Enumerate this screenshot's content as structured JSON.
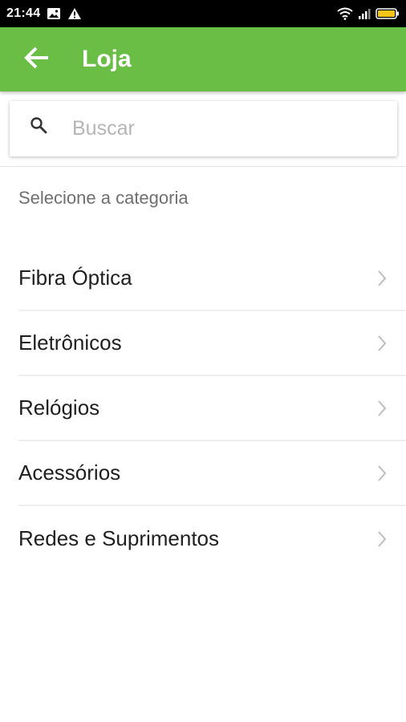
{
  "status_bar": {
    "time": "21:44",
    "icons": [
      "image-icon",
      "alert-icon",
      "wifi-icon",
      "signal-icon",
      "battery-icon"
    ]
  },
  "app_bar": {
    "title": "Loja",
    "color": "#6abe45",
    "back_icon": "arrow-left-icon"
  },
  "search": {
    "placeholder": "Buscar",
    "value": "",
    "icon": "search-icon"
  },
  "section": {
    "label": "Selecione a categoria"
  },
  "categories": [
    {
      "label": "Fibra Óptica"
    },
    {
      "label": "Eletrônicos"
    },
    {
      "label": "Relógios"
    },
    {
      "label": "Acessórios"
    },
    {
      "label": "Redes e Suprimentos"
    }
  ]
}
